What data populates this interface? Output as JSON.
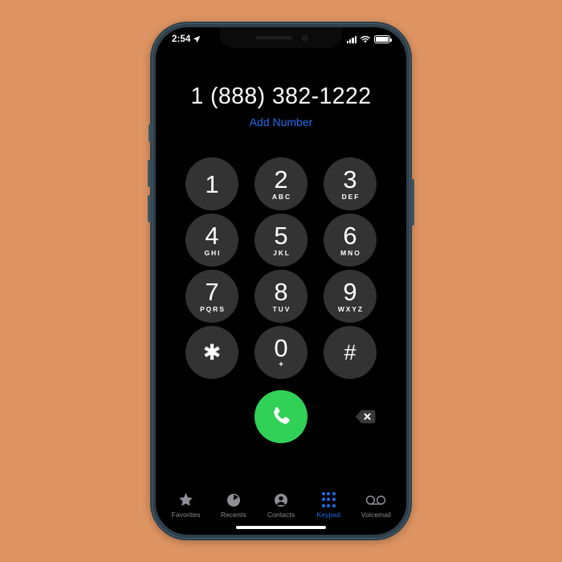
{
  "device": {
    "frame_color": "#2e3f4a",
    "background_color": "#de9462"
  },
  "status_bar": {
    "time": "2:54",
    "location_icon": "location-arrow-icon",
    "signal_icon": "signal-bars-icon",
    "wifi_icon": "wifi-icon",
    "battery_icon": "battery-icon"
  },
  "number_display": {
    "number": "1 (888) 382-1222",
    "add_number_label": "Add Number",
    "accent_color": "#1f6dec"
  },
  "keypad": {
    "keys": [
      {
        "digit": "1",
        "letters": ""
      },
      {
        "digit": "2",
        "letters": "ABC"
      },
      {
        "digit": "3",
        "letters": "DEF"
      },
      {
        "digit": "4",
        "letters": "GHI"
      },
      {
        "digit": "5",
        "letters": "JKL"
      },
      {
        "digit": "6",
        "letters": "MNO"
      },
      {
        "digit": "7",
        "letters": "PQRS"
      },
      {
        "digit": "8",
        "letters": "TUV"
      },
      {
        "digit": "9",
        "letters": "WXYZ"
      },
      {
        "digit": "✱",
        "letters": ""
      },
      {
        "digit": "0",
        "letters": "+"
      },
      {
        "digit": "#",
        "letters": ""
      }
    ],
    "key_color": "#333333"
  },
  "call_row": {
    "call_icon": "phone-handset-icon",
    "call_color": "#31d158",
    "backspace_icon": "backspace-delete-icon"
  },
  "tab_bar": {
    "items": [
      {
        "label": "Favorites",
        "icon": "star-icon",
        "active": false
      },
      {
        "label": "Recents",
        "icon": "clock-icon",
        "active": false
      },
      {
        "label": "Contacts",
        "icon": "person-circle-icon",
        "active": false
      },
      {
        "label": "Keypad",
        "icon": "keypad-dots-icon",
        "active": true
      },
      {
        "label": "Voicemail",
        "icon": "voicemail-tape-icon",
        "active": false
      }
    ],
    "active_color": "#1f6dec",
    "inactive_color": "#8e8e93"
  }
}
